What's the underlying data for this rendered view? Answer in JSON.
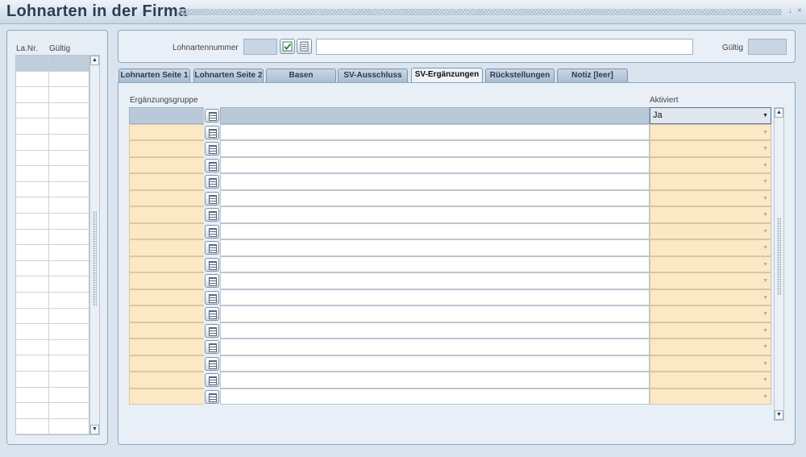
{
  "window": {
    "title": "Lohnarten in der Firma"
  },
  "left_list": {
    "headers": [
      "La.Nr.",
      "Gültig"
    ],
    "row_count": 24
  },
  "header": {
    "lohnartennummer_label": "Lohnartennummer",
    "lohnartennummer_value": "",
    "description_value": "",
    "gueltig_label": "Gültig",
    "gueltig_value": ""
  },
  "tabs": [
    {
      "label": "Lohnarten Seite 1",
      "active": false
    },
    {
      "label": "Lohnarten Seite 2",
      "active": false
    },
    {
      "label": "Basen",
      "active": false
    },
    {
      "label": "SV-Ausschluss",
      "active": false
    },
    {
      "label": "SV-Ergänzungen",
      "active": true
    },
    {
      "label": "Rückstellungen",
      "active": false
    },
    {
      "label": "Notiz [leer]",
      "active": false
    }
  ],
  "grid": {
    "col_group_label": "Ergänzungsgruppe",
    "col_active_label": "Aktiviert",
    "rows": [
      {
        "code": "",
        "desc": "",
        "active": "Ja"
      },
      {
        "code": "",
        "desc": "",
        "active": ""
      },
      {
        "code": "",
        "desc": "",
        "active": ""
      },
      {
        "code": "",
        "desc": "",
        "active": ""
      },
      {
        "code": "",
        "desc": "",
        "active": ""
      },
      {
        "code": "",
        "desc": "",
        "active": ""
      },
      {
        "code": "",
        "desc": "",
        "active": ""
      },
      {
        "code": "",
        "desc": "",
        "active": ""
      },
      {
        "code": "",
        "desc": "",
        "active": ""
      },
      {
        "code": "",
        "desc": "",
        "active": ""
      },
      {
        "code": "",
        "desc": "",
        "active": ""
      },
      {
        "code": "",
        "desc": "",
        "active": ""
      },
      {
        "code": "",
        "desc": "",
        "active": ""
      },
      {
        "code": "",
        "desc": "",
        "active": ""
      },
      {
        "code": "",
        "desc": "",
        "active": ""
      },
      {
        "code": "",
        "desc": "",
        "active": ""
      },
      {
        "code": "",
        "desc": "",
        "active": ""
      },
      {
        "code": "",
        "desc": "",
        "active": ""
      }
    ]
  },
  "icons": {
    "minimize": "minimize-icon",
    "close": "close-icon",
    "lov": "list-icon",
    "check": "check-icon"
  },
  "colors": {
    "accent": "#fce8c3",
    "selected_row": "#b9c9d9",
    "panel": "#e8eff6"
  }
}
